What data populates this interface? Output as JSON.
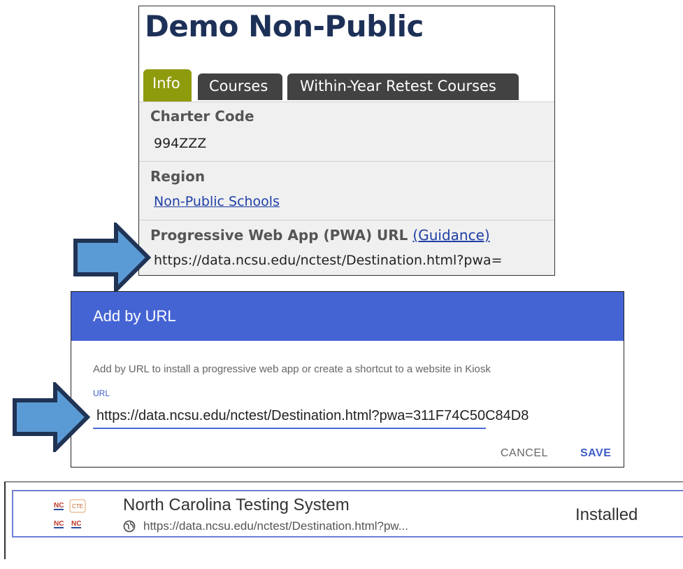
{
  "school": {
    "title": "Demo Non-Public",
    "tabs": [
      "Info",
      "Courses",
      "Within-Year Retest Courses"
    ],
    "charter_label": "Charter Code",
    "charter_value": "994ZZZ",
    "region_label": "Region",
    "region_value": "Non-Public Schools",
    "pwa_label": "Progressive Web App (PWA) URL",
    "guidance_link": "(Guidance)",
    "pwa_url": "https://data.ncsu.edu/nctest/Destination.html?pwa="
  },
  "dialog": {
    "title": "Add by URL",
    "description": "Add by URL to install a progressive web app or create a shortcut to a website in Kiosk",
    "url_label": "URL",
    "url_value": "https://data.ncsu.edu/nctest/Destination.html?pwa=311F74C50C84D8",
    "cancel": "CANCEL",
    "save": "SAVE"
  },
  "app": {
    "name": "North Carolina Testing System",
    "url": "https://data.ncsu.edu/nctest/Destination.html?pw...",
    "status": "Installed",
    "icon_labels": [
      "NC",
      "CTE",
      "NC",
      "NC"
    ]
  },
  "colors": {
    "title": "#1d3057",
    "tab_active": "#8e9b0c",
    "tab_inactive": "#424242",
    "dialog_header": "#4464d4",
    "accent": "#3d5cc9",
    "arrow_fill": "#5b9bd5",
    "arrow_stroke": "#1f3354"
  }
}
